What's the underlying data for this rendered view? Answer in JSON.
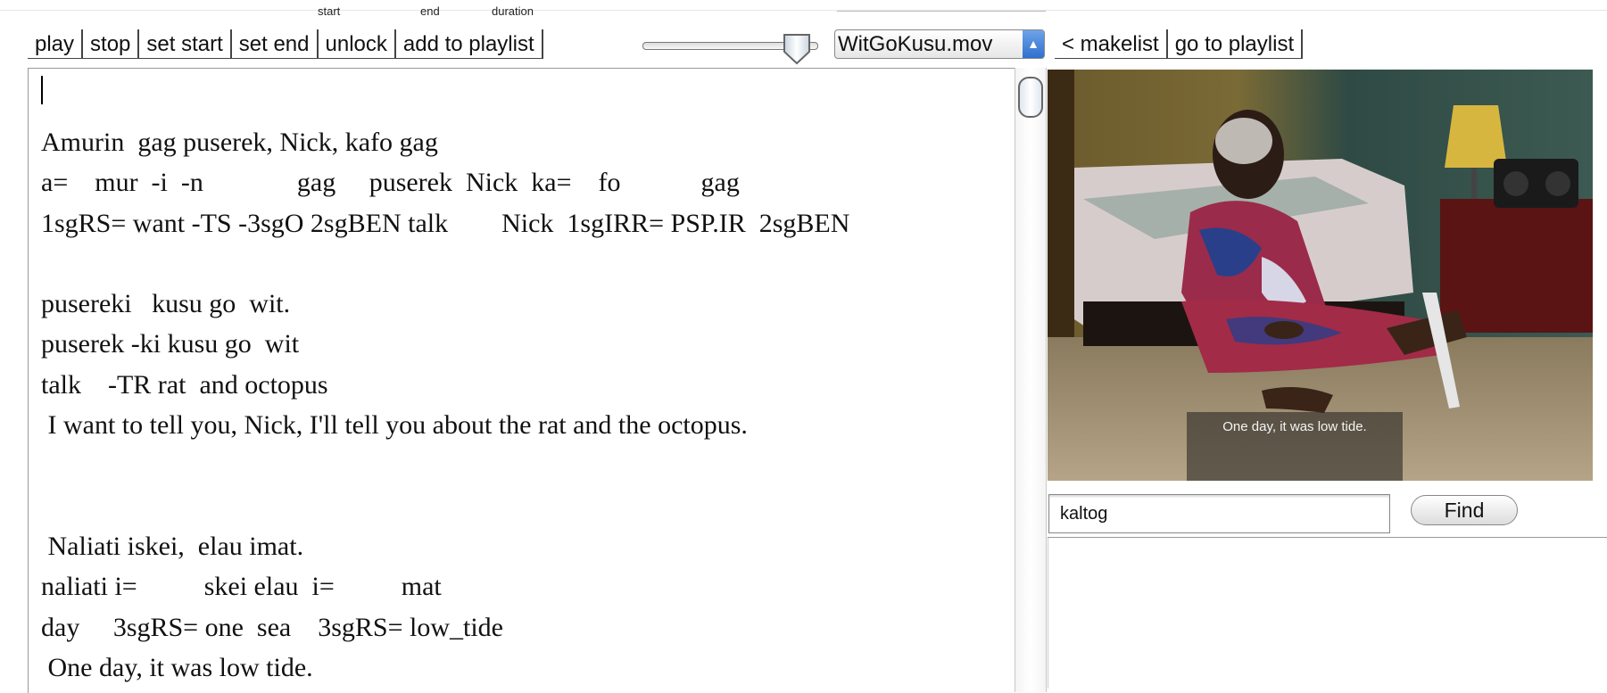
{
  "labels": {
    "start": "start",
    "end": "end",
    "duration": "duration"
  },
  "toolbar": {
    "play": "play",
    "stop": "stop",
    "set_start": "set start",
    "set_end": "set end",
    "unlock": "unlock",
    "add_to_playlist": "add to playlist"
  },
  "slider": {
    "value_fraction": 0.87
  },
  "media_select": {
    "selected": "WitGoKusu.mov"
  },
  "right_toolbar": {
    "makelist": "< makelist",
    "go_to_playlist": "go to playlist"
  },
  "editor": {
    "lines": [
      "Amurin  gag puserek, Nick, kafo gag",
      "a=    mur  -i  -n              gag     puserek  Nick  ka=    fo            gag",
      "1sgRS= want -TS -3sgO 2sgBEN talk        Nick  1sgIRR= PSP.IR  2sgBEN",
      "",
      "pusereki   kusu go  wit.",
      "puserek -ki kusu go  wit",
      "talk    -TR rat  and octopus",
      " I want to tell you, Nick, I'll tell you about the rat and the octopus.",
      "",
      "",
      " Naliati iskei,  elau imat.",
      "naliati i=          skei elau  i=          mat",
      "day     3sgRS= one  sea    3sgRS= low_tide",
      " One day, it was low tide."
    ]
  },
  "video": {
    "subtitle": "One day, it was low tide."
  },
  "search": {
    "value": "kaltog",
    "find_label": "Find"
  },
  "colors": {
    "select_arrow": "#3b7bd8"
  }
}
